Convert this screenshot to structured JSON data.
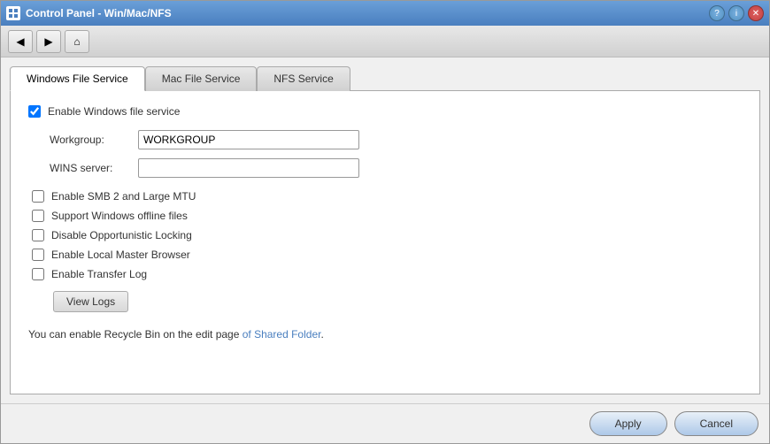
{
  "window": {
    "title": "Control Panel - Win/Mac/NFS"
  },
  "toolbar": {
    "back_label": "◀",
    "forward_label": "▶",
    "home_label": "⌂"
  },
  "tabs": [
    {
      "id": "windows",
      "label": "Windows File Service",
      "active": true
    },
    {
      "id": "mac",
      "label": "Mac File Service",
      "active": false
    },
    {
      "id": "nfs",
      "label": "NFS Service",
      "active": false
    }
  ],
  "form": {
    "enable_windows_label": "Enable Windows file service",
    "enable_windows_checked": true,
    "workgroup_label": "Workgroup:",
    "workgroup_value": "WORKGROUP",
    "wins_label": "WINS server:",
    "wins_value": "",
    "enable_smb2_label": "Enable SMB 2 and Large MTU",
    "enable_smb2_checked": false,
    "support_offline_label": "Support Windows offline files",
    "support_offline_checked": false,
    "disable_oplocking_label": "Disable Opportunistic Locking",
    "disable_oplocking_checked": false,
    "enable_master_browser_label": "Enable Local Master Browser",
    "enable_master_browser_checked": false,
    "enable_transfer_log_label": "Enable Transfer Log",
    "enable_transfer_log_checked": false,
    "view_logs_label": "View Logs",
    "info_text_1": "You can enable Recycle Bin on the edit page ",
    "info_text_link": "of Shared Folder",
    "info_text_2": "."
  },
  "footer": {
    "apply_label": "Apply",
    "cancel_label": "Cancel"
  }
}
